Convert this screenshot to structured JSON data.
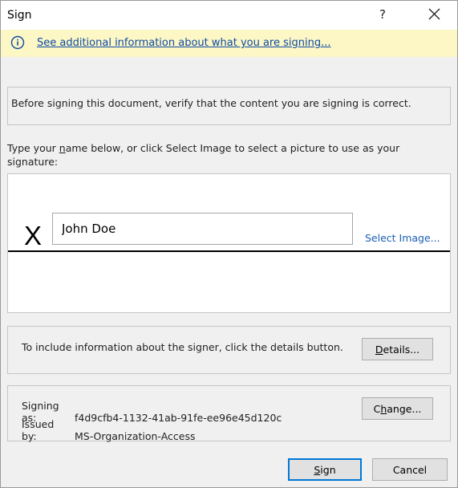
{
  "dialog": {
    "title": "Sign",
    "help_glyph": "?"
  },
  "infobar": {
    "link_text": "See additional information about what you are signing..."
  },
  "verify_text": "Before signing this document, verify that the content you are signing is correct.",
  "signature": {
    "prompt_before": "Type your ",
    "prompt_accel": "n",
    "prompt_after": "ame below, or click Select Image to select a picture to use as your signature:",
    "x_mark": "X",
    "name_value": "John Doe",
    "select_image": "Select Image..."
  },
  "details": {
    "text": "To include information about the signer, click the details button.",
    "button_accel": "D",
    "button_rest": "etails..."
  },
  "certificate": {
    "signing_as_label": "Signing as:",
    "signing_as_value": "f4d9cfb4-1132-41ab-91fe-ee96e45d120c",
    "issued_by_label": "Issued by:",
    "issued_by_value": "MS-Organization-Access",
    "change_before": "C",
    "change_accel": "h",
    "change_after": "ange..."
  },
  "footer": {
    "sign_accel": "S",
    "sign_rest": "ign",
    "cancel_label": "Cancel"
  },
  "colors": {
    "infobar_bg": "#fcf7c5",
    "link": "#0d4aa6",
    "default_button_border": "#0078d7"
  },
  "icons": {
    "info": "info-circle-icon",
    "close": "close-icon"
  }
}
